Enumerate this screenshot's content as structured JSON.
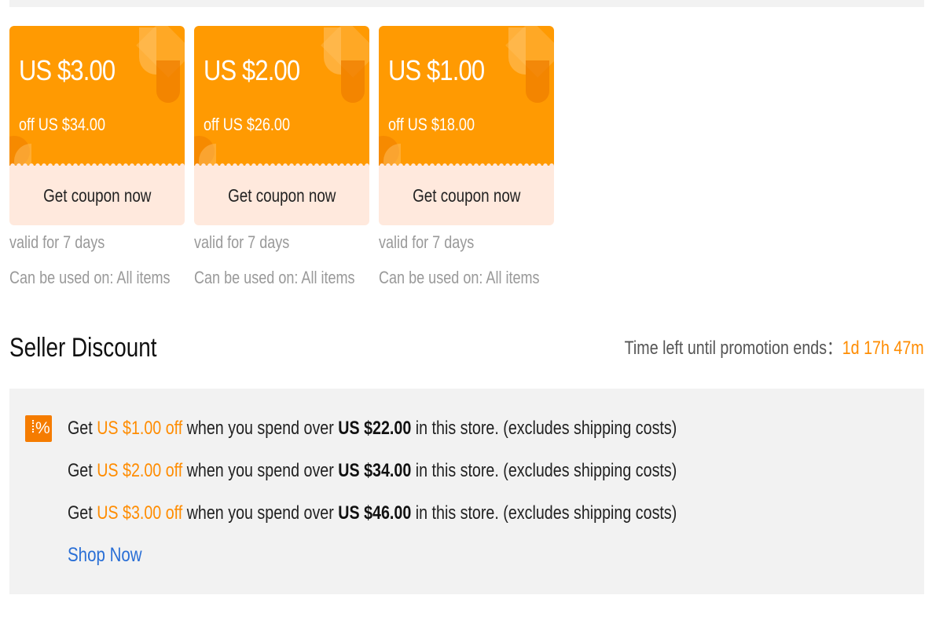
{
  "coupons": [
    {
      "amount": "US $3.00",
      "min_spend": "off US $34.00",
      "button": "Get coupon now",
      "validity": "valid for 7 days",
      "usage": "Can be used on: All items"
    },
    {
      "amount": "US $2.00",
      "min_spend": "off US $26.00",
      "button": "Get coupon now",
      "validity": "valid for 7 days",
      "usage": "Can be used on: All items"
    },
    {
      "amount": "US $1.00",
      "min_spend": "off US $18.00",
      "button": "Get coupon now",
      "validity": "valid for 7 days",
      "usage": "Can be used on: All items"
    }
  ],
  "seller_discount": {
    "title": "Seller Discount",
    "countdown_label": "Time left until promotion ends：",
    "countdown_value": "1d 17h 47m",
    "icon": "percent-tag-icon",
    "icon_glyph": "%",
    "rules": [
      {
        "prefix": "Get ",
        "discount": "US $1.00 off",
        "middle": " when you spend over ",
        "threshold": "US $22.00",
        "suffix": " in this store. (excludes shipping costs)"
      },
      {
        "prefix": "Get ",
        "discount": "US $2.00 off",
        "middle": " when you spend over ",
        "threshold": "US $34.00",
        "suffix": " in this store. (excludes shipping costs)"
      },
      {
        "prefix": "Get ",
        "discount": "US $3.00 off",
        "middle": " when you spend over ",
        "threshold": "US $46.00",
        "suffix": " in this store. (excludes shipping costs)"
      }
    ],
    "shop_now": "Shop Now"
  },
  "colors": {
    "coupon_orange": "#ff9a02",
    "coupon_bottom": "#ffe9dd",
    "highlight_orange": "#ff8c00",
    "link_blue": "#2a6fd6",
    "panel_gray": "#f2f2f2"
  }
}
